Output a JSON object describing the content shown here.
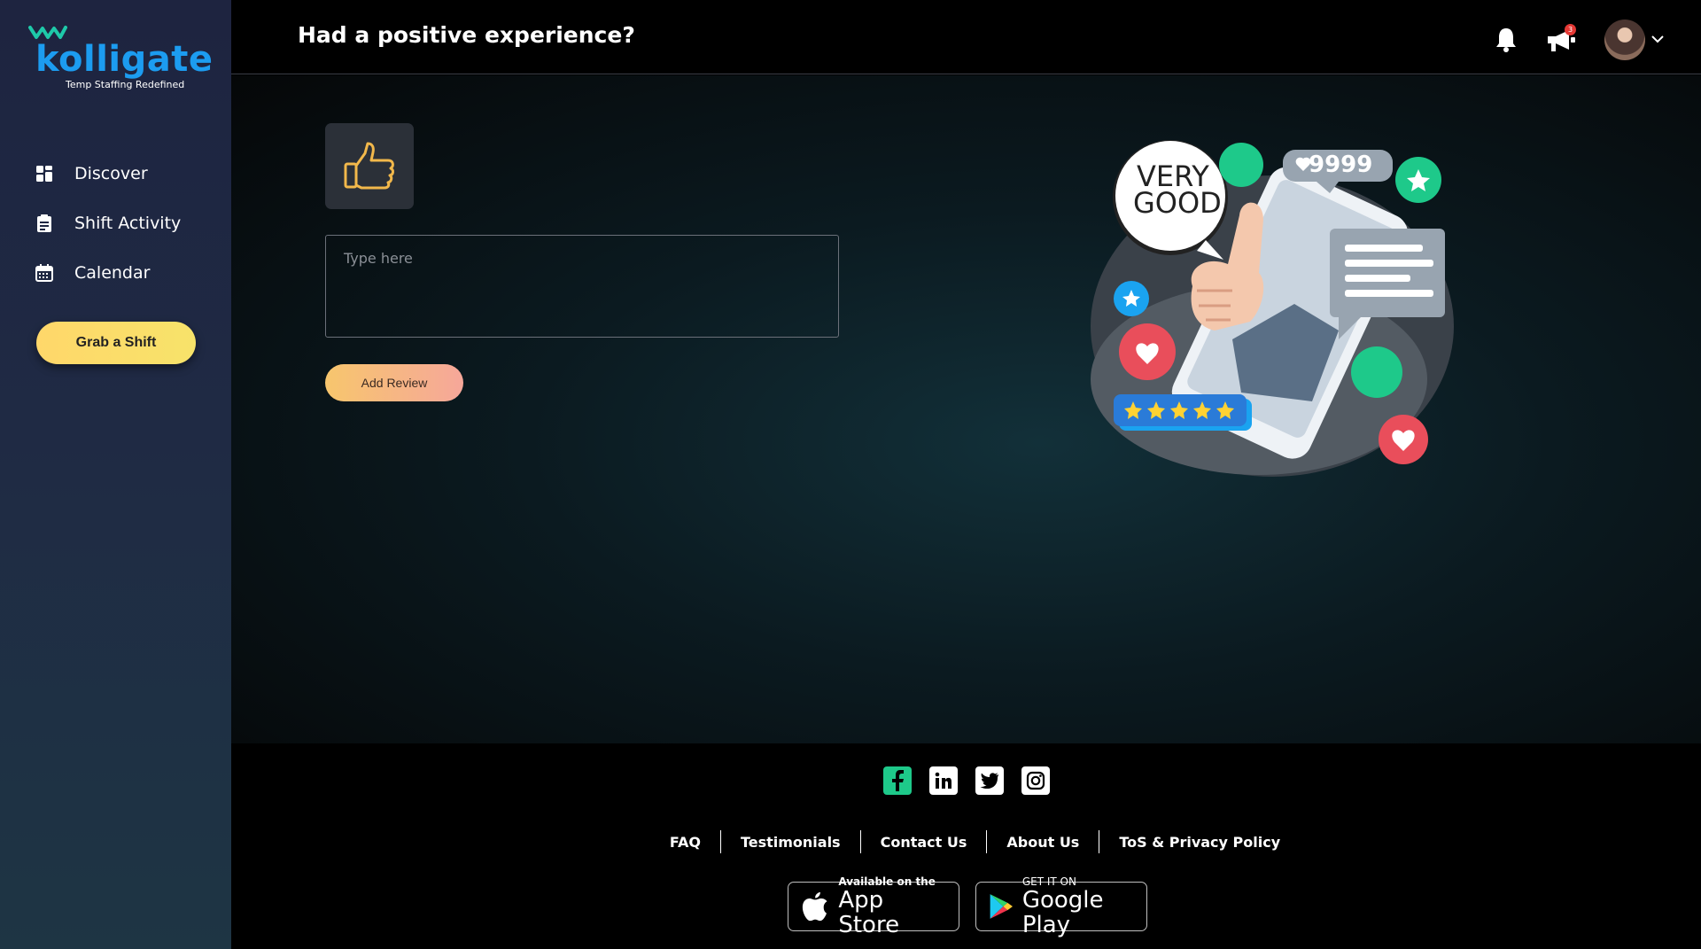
{
  "brand": {
    "name": "kolligate",
    "tagline": "Temp Staffing Redefined",
    "accent": "#1c9cf0"
  },
  "sidebar": {
    "items": [
      {
        "label": "Discover",
        "icon": "grid-icon"
      },
      {
        "label": "Shift Activity",
        "icon": "clipboard-icon"
      },
      {
        "label": "Calendar",
        "icon": "calendar-icon"
      }
    ],
    "cta_label": "Grab a Shift"
  },
  "header": {
    "title": "Had a positive experience?",
    "notification_count": "3"
  },
  "review": {
    "placeholder": "Type here",
    "value": "",
    "submit_label": "Add Review"
  },
  "illustration": {
    "bubble_text_1": "VERY",
    "bubble_text_2": "GOOD",
    "likes_count": "9999",
    "rating_stars": 5
  },
  "footer": {
    "socials": [
      "facebook-icon",
      "linkedin-icon",
      "twitter-icon",
      "instagram-icon"
    ],
    "links": [
      "FAQ",
      "Testimonials",
      "Contact Us",
      "About Us",
      "ToS & Privacy Policy"
    ],
    "app_store": {
      "small": "Available on the",
      "big": "App Store"
    },
    "google_play": {
      "small": "GET IT ON",
      "big": "Google Play"
    }
  }
}
